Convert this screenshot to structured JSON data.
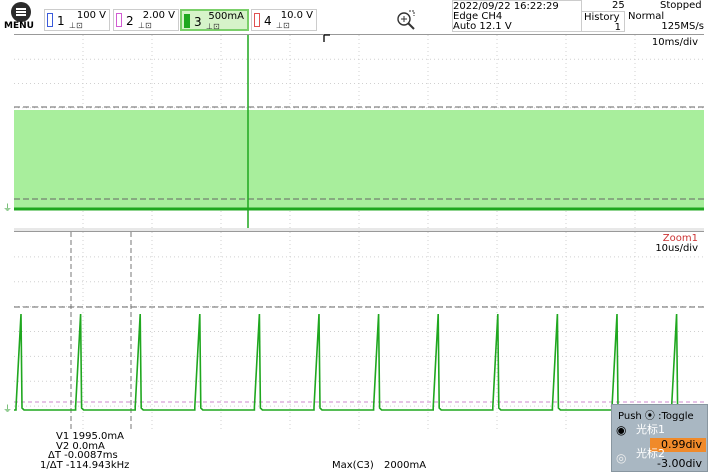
{
  "menu": {
    "label": "MENU"
  },
  "channels": [
    {
      "num": "1",
      "scale": "100 V",
      "coupling": "ⅲ",
      "color": "#3b5bdb"
    },
    {
      "num": "2",
      "scale": "2.00 V",
      "coupling": "ⅲ",
      "color": "#d25bd2"
    },
    {
      "num": "3",
      "scale": "500mA",
      "coupling": "ⅲ",
      "color": "#1fa71f"
    },
    {
      "num": "4",
      "scale": "10.0 V",
      "coupling": "ⅲ",
      "color": "#e05050"
    }
  ],
  "trigger": {
    "datetime": "2022/09/22 16:22:29",
    "mode": "Edge CH4",
    "level": "Auto 12.1 V"
  },
  "acquisition": {
    "count": "25",
    "state": "Stopped",
    "history_label": "History",
    "history_value": "1",
    "acq_mode": "Normal",
    "sample_rate": "125MS/s"
  },
  "top_plot": {
    "timebase": "10ms/div"
  },
  "bottom_plot": {
    "zoom_label": "Zoom1",
    "timebase": "10us/div"
  },
  "cursors": {
    "v1": "V1  1995.0mA",
    "v2": "V2  0.0mA",
    "dt": "ΔT -0.0087ms",
    "inv_dt": "1/ΔT -114.943kHz"
  },
  "measurement": {
    "name": "Max(C3)",
    "value": "2000mA"
  },
  "toggle_panel": {
    "title": "Push ⦿ :Toggle",
    "cursor1_label": "光标1",
    "cursor1_value": "0.99div",
    "cursor2_label": "光标2",
    "cursor2_value": "-3.00div"
  },
  "colors": {
    "trace": "#1fa71f",
    "fill": "#a8ee9c",
    "accent": "#f08a2a"
  }
}
